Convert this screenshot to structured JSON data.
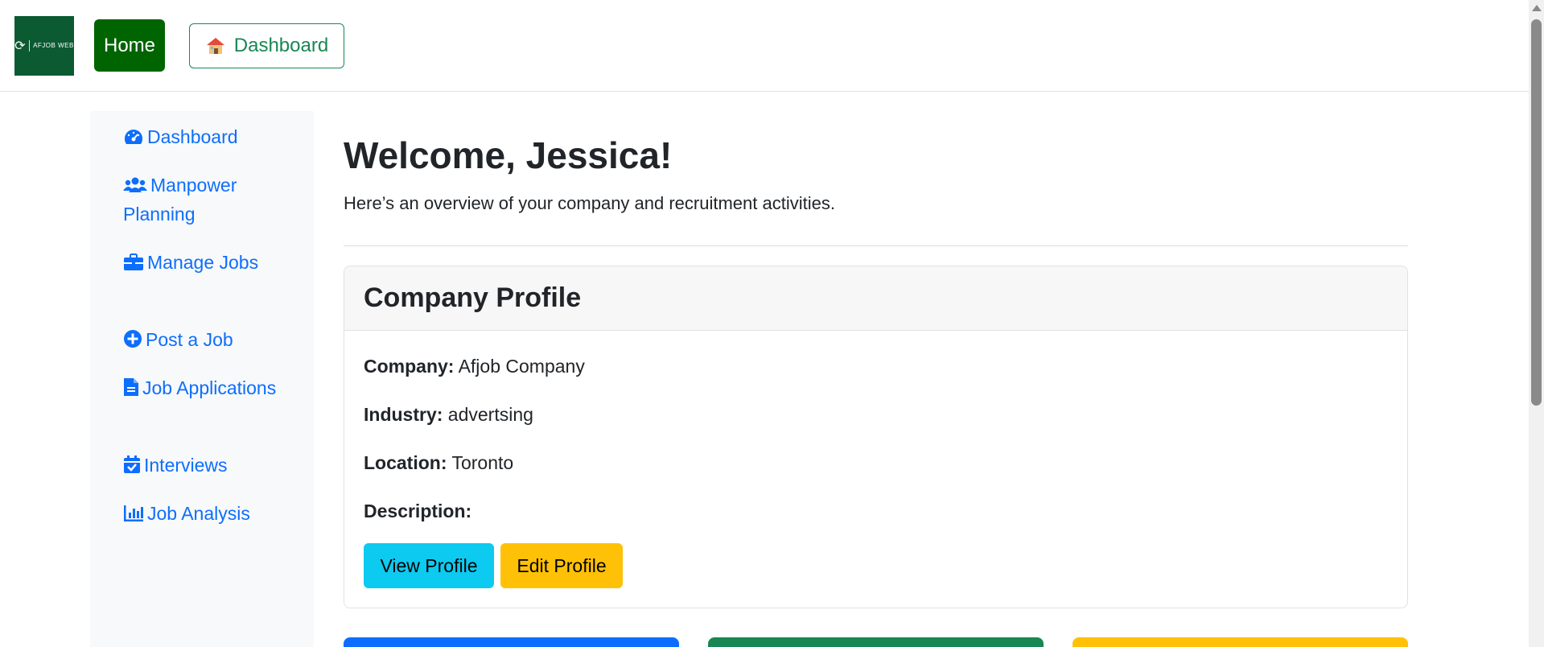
{
  "navbar": {
    "logo_text": "AFJOB WEB",
    "home_label": "Home",
    "dashboard_label": "Dashboard"
  },
  "sidebar": {
    "items": [
      {
        "label": "Dashboard",
        "icon": "gauge-icon"
      },
      {
        "label": "Manpower Planning",
        "icon": "users-icon"
      },
      {
        "label": "Manage Jobs",
        "icon": "briefcase-icon"
      },
      {
        "label": "Post a Job",
        "icon": "plus-circle-icon"
      },
      {
        "label": "Job Applications",
        "icon": "file-icon"
      },
      {
        "label": "Interviews",
        "icon": "calendar-check-icon"
      },
      {
        "label": "Job Analysis",
        "icon": "bar-chart-icon"
      }
    ]
  },
  "main": {
    "welcome": "Welcome, Jessica!",
    "overview": "Here’s an overview of your company and recruitment activities.",
    "profile": {
      "title": "Company Profile",
      "company_label": "Company:",
      "company_value": "Afjob Company",
      "industry_label": "Industry:",
      "industry_value": "advertsing",
      "location_label": "Location:",
      "location_value": "Toronto",
      "description_label": "Description:",
      "description_value": "",
      "view_button": "View Profile",
      "edit_button": "Edit Profile"
    }
  },
  "colors": {
    "accent_blue": "#0d6efd",
    "accent_green": "#198754",
    "accent_yellow": "#ffc107",
    "home_green": "#006400",
    "info_cyan": "#0dcaf0"
  }
}
